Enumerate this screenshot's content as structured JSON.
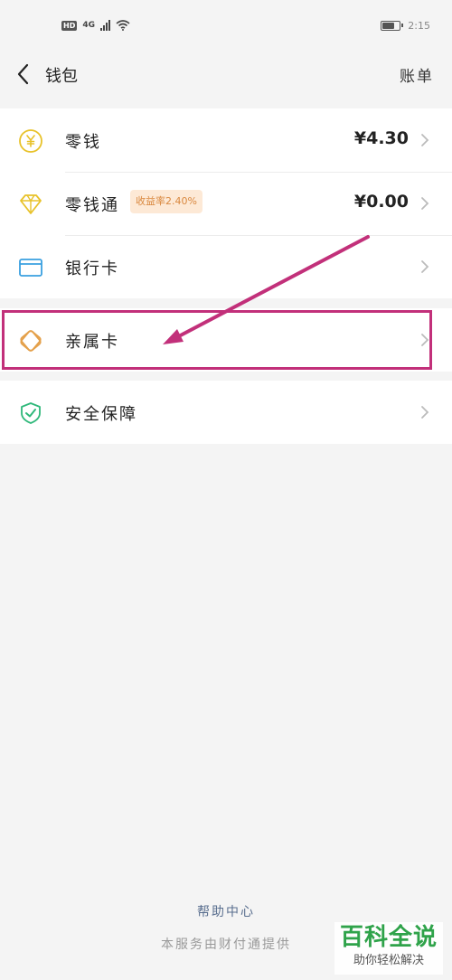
{
  "status_bar": {
    "hd_label": "HD",
    "network_label": "4G",
    "time": "2:15",
    "battery_level": 0.75
  },
  "header": {
    "title": "钱包",
    "right_action": "账单"
  },
  "wallet_items": [
    {
      "label": "零钱",
      "value": "¥4.30",
      "icon": "yen-coin-icon"
    },
    {
      "label": "零钱通",
      "badge": "收益率2.40%",
      "value": "¥0.00",
      "icon": "diamond-icon"
    },
    {
      "label": "银行卡",
      "icon": "bank-card-icon"
    }
  ],
  "family_card": {
    "label": "亲属卡",
    "icon": "family-card-icon"
  },
  "security": {
    "label": "安全保障",
    "icon": "shield-check-icon"
  },
  "footer": {
    "help": "帮助中心",
    "provider": "本服务由财付通提供"
  },
  "watermark": {
    "title": "百科全说",
    "subtitle": "助你轻松解决"
  },
  "colors": {
    "annotation": "#c2307a",
    "coin": "#e8c22a",
    "bank": "#3aa0e0",
    "family": "#e4a04a",
    "security": "#2fb87a"
  }
}
